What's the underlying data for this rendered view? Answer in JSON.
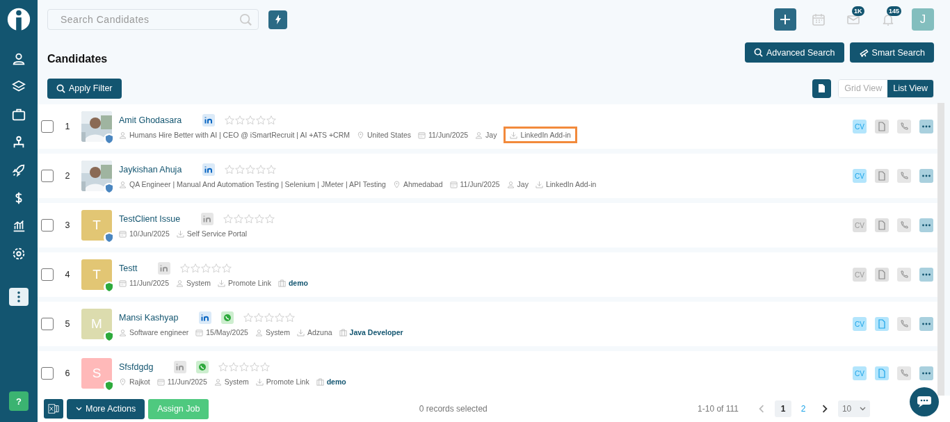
{
  "search": {
    "placeholder": "Search Candidates"
  },
  "header": {
    "mail_badge": "1K",
    "bell_badge": "145",
    "avatar": "J"
  },
  "title": "Candidates",
  "buttons": {
    "advanced_search": "Advanced Search",
    "smart_search": "Smart Search",
    "apply_filter": "Apply Filter"
  },
  "views": [
    {
      "label": "Grid View",
      "selected": false
    },
    {
      "label": "List View",
      "selected": true
    }
  ],
  "rows": [
    {
      "checked": false,
      "number": "1",
      "name": "Amit Ghodasara",
      "avatar": {
        "kind": "picture"
      },
      "shield": {
        "color": "#4a86c0"
      },
      "linkedin_active": true,
      "whatsapp": false,
      "stars": 0,
      "cv_label": "CV",
      "cv_active": true,
      "doc_active": false,
      "meta": [
        {
          "kind": "person",
          "text": "Humans Hire Better with AI | CEO @ iSmartRecruit | AI +ATS +CRM",
          "highlighted": false
        },
        {
          "kind": "location",
          "text": "United States",
          "highlighted": false
        },
        {
          "kind": "date",
          "text": "11/Jun/2025",
          "highlighted": false
        },
        {
          "kind": "person",
          "text": "Jay",
          "highlighted": false
        },
        {
          "kind": "source",
          "text": "LinkedIn Add-in",
          "highlighted": true
        }
      ]
    },
    {
      "checked": false,
      "number": "2",
      "name": "Jaykishan Ahuja",
      "avatar": {
        "kind": "picture"
      },
      "shield": {
        "color": "#4a86c0"
      },
      "linkedin_active": true,
      "whatsapp": false,
      "stars": 0,
      "cv_label": "CV",
      "cv_active": true,
      "doc_active": false,
      "meta": [
        {
          "kind": "person",
          "text": "QA Engineer | Manual And Automation Testing | Selenium | JMeter | API Testing",
          "highlighted": false
        },
        {
          "kind": "location",
          "text": "Ahmedabad",
          "highlighted": false
        },
        {
          "kind": "date",
          "text": "11/Jun/2025",
          "highlighted": false
        },
        {
          "kind": "person",
          "text": "Jay",
          "highlighted": false
        },
        {
          "kind": "source",
          "text": "LinkedIn Add-in",
          "highlighted": false
        }
      ]
    },
    {
      "checked": false,
      "number": "3",
      "name": "TestClient Issue",
      "avatar": {
        "kind": "letter",
        "letter": "T",
        "color": "#e2c674"
      },
      "shield": {
        "color": "#4a86c0"
      },
      "linkedin_active": false,
      "whatsapp": false,
      "stars": 0,
      "cv_label": "CV",
      "cv_active": false,
      "doc_active": false,
      "meta": [
        {
          "kind": "date",
          "text": "10/Jun/2025",
          "highlighted": false
        },
        {
          "kind": "source",
          "text": "Self Service Portal",
          "highlighted": false
        }
      ]
    },
    {
      "checked": false,
      "number": "4",
      "name": "Testt",
      "avatar": {
        "kind": "letter",
        "letter": "T",
        "color": "#e2c674"
      },
      "shield": {
        "color": "#2eaa3c"
      },
      "linkedin_active": false,
      "whatsapp": false,
      "stars": 0,
      "cv_label": "CV",
      "cv_active": false,
      "doc_active": false,
      "meta": [
        {
          "kind": "date",
          "text": "11/Jun/2025",
          "highlighted": false
        },
        {
          "kind": "person",
          "text": "System",
          "highlighted": false
        },
        {
          "kind": "source",
          "text": "Promote Link",
          "highlighted": false
        },
        {
          "kind": "job",
          "text": "demo",
          "highlighted": false
        }
      ]
    },
    {
      "checked": false,
      "number": "5",
      "name": "Mansi Kashyap",
      "avatar": {
        "kind": "letter",
        "letter": "M",
        "color": "#dcdcae"
      },
      "shield": {
        "color": "#2eaa3c"
      },
      "linkedin_active": true,
      "whatsapp": true,
      "stars": 0,
      "cv_label": "CV",
      "cv_active": true,
      "doc_active": true,
      "meta": [
        {
          "kind": "person",
          "text": "Software engineer",
          "highlighted": false
        },
        {
          "kind": "date",
          "text": "15/May/2025",
          "highlighted": false
        },
        {
          "kind": "person",
          "text": "System",
          "highlighted": false
        },
        {
          "kind": "source",
          "text": "Adzuna",
          "highlighted": false
        },
        {
          "kind": "job",
          "text": "Java Developer",
          "highlighted": false
        }
      ]
    },
    {
      "checked": false,
      "number": "6",
      "name": "Sfsfdgdg",
      "avatar": {
        "kind": "letter",
        "letter": "S",
        "color": "#ffb9b9"
      },
      "shield": {
        "color": "#2eaa3c"
      },
      "linkedin_active": false,
      "whatsapp": true,
      "stars": 0,
      "cv_label": "CV",
      "cv_active": true,
      "doc_active": true,
      "meta": [
        {
          "kind": "location",
          "text": "Rajkot",
          "highlighted": false
        },
        {
          "kind": "date",
          "text": "11/Jun/2025",
          "highlighted": false
        },
        {
          "kind": "person",
          "text": "System",
          "highlighted": false
        },
        {
          "kind": "source",
          "text": "Promote Link",
          "highlighted": false
        },
        {
          "kind": "job",
          "text": "demo",
          "highlighted": false
        }
      ]
    }
  ],
  "footer": {
    "more_actions": "More Actions",
    "assign_job": "Assign Job",
    "selection": "0 records selected",
    "range": "1-10 of 111",
    "pages": [
      {
        "label": "1",
        "selected": true
      },
      {
        "label": "2",
        "selected": false
      }
    ],
    "page_size": "10"
  },
  "help": "?"
}
